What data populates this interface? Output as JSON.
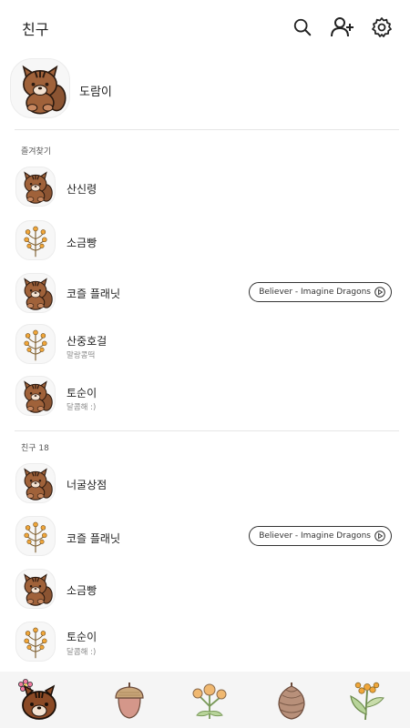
{
  "header": {
    "title": "친구",
    "icons": [
      "search-icon",
      "add-friend-icon",
      "settings-icon"
    ]
  },
  "profile": {
    "name": "도람이",
    "avatar": "squirrel"
  },
  "favorites": {
    "label": "즐겨찾기",
    "items": [
      {
        "name": "산신령",
        "status": "",
        "avatar": "squirrel",
        "music": ""
      },
      {
        "name": "소금빵",
        "status": "",
        "avatar": "flower",
        "music": ""
      },
      {
        "name": "코즐 플래닛",
        "status": "",
        "avatar": "squirrel",
        "music": "Believer - Imagine Dragons"
      },
      {
        "name": "산중호걸",
        "status": "말랑콩떡",
        "avatar": "flower",
        "music": ""
      },
      {
        "name": "토순이",
        "status": "달콤해 :)",
        "avatar": "squirrel",
        "music": ""
      }
    ]
  },
  "friends": {
    "label": "친구 18",
    "items": [
      {
        "name": "너굴상점",
        "status": "",
        "avatar": "squirrel",
        "music": ""
      },
      {
        "name": "코즐 플래닛",
        "status": "",
        "avatar": "flower",
        "music": "Believer - Imagine Dragons"
      },
      {
        "name": "소금빵",
        "status": "",
        "avatar": "squirrel",
        "music": ""
      },
      {
        "name": "토순이",
        "status": "달콤해 :)",
        "avatar": "flower",
        "music": ""
      }
    ]
  },
  "bottom_nav": {
    "tabs": [
      "squirrel-tab",
      "acorn-tab",
      "flowers-tab",
      "pinecone-tab",
      "plant-tab"
    ]
  },
  "colors": {
    "fur": "#a0623a",
    "stripe": "#3a2418",
    "berry": "#f0a63a",
    "acorn": "#d4978a",
    "bg": "#ffffff",
    "nav_bg": "#f5f5f5"
  }
}
